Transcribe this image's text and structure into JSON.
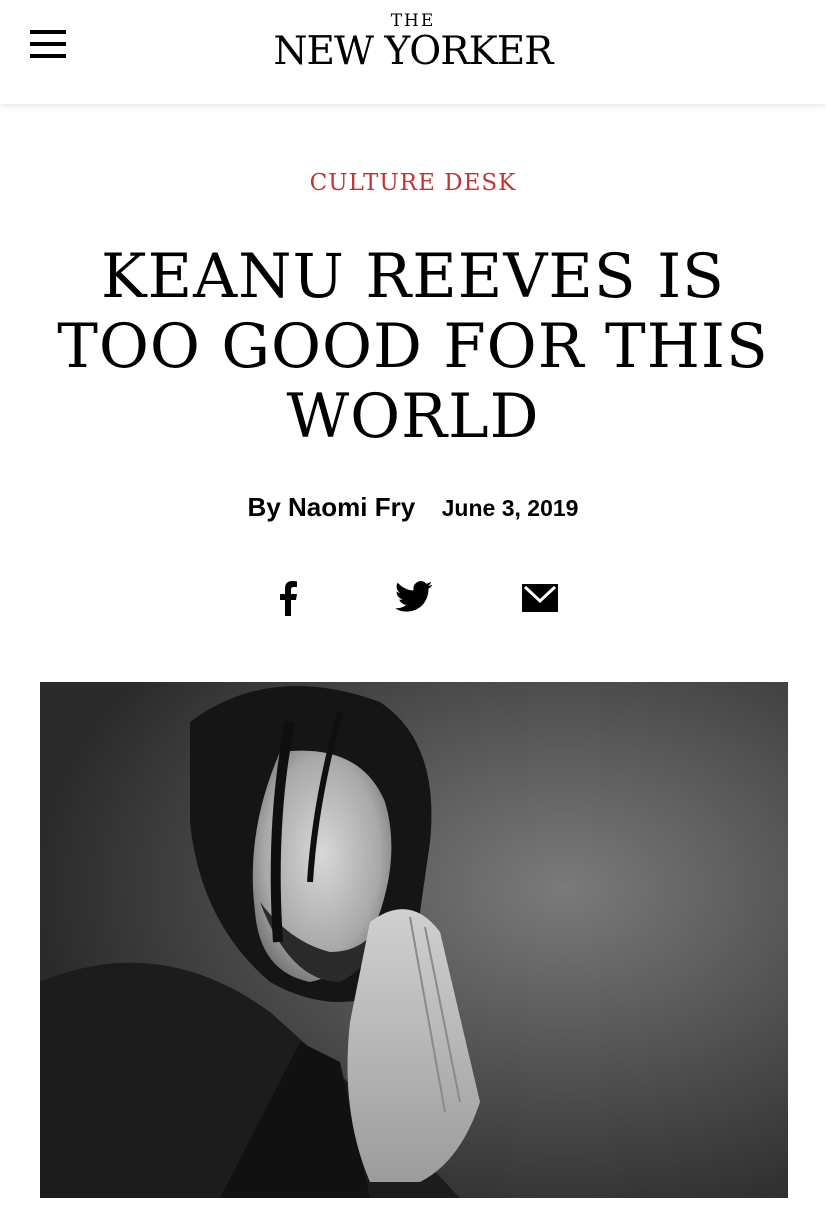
{
  "header": {
    "logo_top": "THE",
    "logo_main": "NEW YORKER"
  },
  "article": {
    "rubric": "CULTURE DESK",
    "title": "KEANU REEVES IS TOO GOOD FOR THIS WORLD",
    "byline_prefix": "By",
    "author": "Naomi Fry",
    "date": "June 3, 2019"
  },
  "share": {
    "icons": [
      "facebook-icon",
      "twitter-icon",
      "email-icon"
    ]
  },
  "colors": {
    "rubric": "#c4342c",
    "text": "#000000",
    "background": "#ffffff"
  }
}
